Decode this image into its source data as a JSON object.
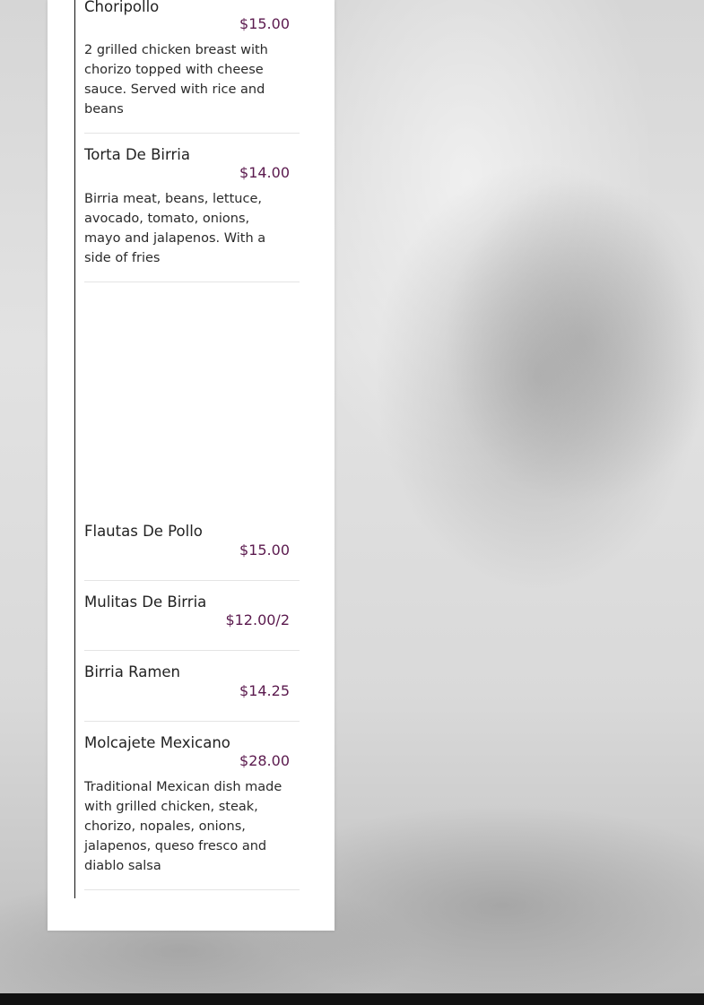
{
  "menu": {
    "items": [
      {
        "name": "Choripollo",
        "price": "$15.00",
        "description": "2 grilled chicken breast with chorizo topped with cheese sauce. Served with rice and beans"
      },
      {
        "name": "Torta De Birria",
        "price": "$14.00",
        "description": "Birria meat, beans, lettuce, avocado, tomato, onions, mayo and jalapenos. With a side of fries"
      },
      {
        "name": "Flautas De Pollo",
        "price": "$15.00"
      },
      {
        "name": "Mulitas De Birria",
        "price": "$12.00/2"
      },
      {
        "name": "Birria Ramen",
        "price": "$14.25"
      },
      {
        "name": "Molcajete Mexicano",
        "price": "$28.00",
        "description": "Traditional Mexican dish made with grilled chicken, steak, chorizo, nopales, onions, jalapenos, queso fresco and diablo salsa"
      }
    ]
  }
}
